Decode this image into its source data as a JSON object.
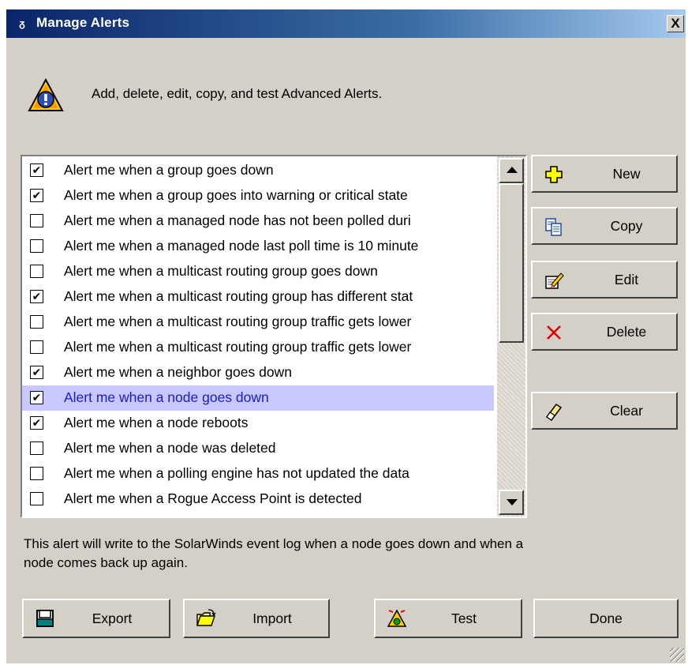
{
  "window": {
    "title": "Manage Alerts",
    "close_label": "X"
  },
  "header": {
    "text": "Add, delete, edit, copy, and test Advanced Alerts."
  },
  "alerts": [
    {
      "label": "Alert me when a group goes down",
      "checked": true
    },
    {
      "label": "Alert me when a group goes into warning or critical state",
      "checked": true
    },
    {
      "label": "Alert me when a managed node has not been polled duri",
      "checked": false
    },
    {
      "label": "Alert me when a managed node last poll time is 10 minute",
      "checked": false
    },
    {
      "label": "Alert me when a multicast routing group goes down",
      "checked": false
    },
    {
      "label": "Alert me when a multicast routing group has different stat",
      "checked": true
    },
    {
      "label": "Alert me when a multicast routing group traffic gets lower",
      "checked": false
    },
    {
      "label": "Alert me when a multicast routing group traffic gets lower",
      "checked": false
    },
    {
      "label": "Alert me when a neighbor goes down",
      "checked": true
    },
    {
      "label": "Alert me when a node goes down",
      "checked": true,
      "selected": true
    },
    {
      "label": "Alert me when a node reboots",
      "checked": true
    },
    {
      "label": "Alert me when a node was deleted",
      "checked": false
    },
    {
      "label": "Alert me when a polling engine has not updated the data",
      "checked": false
    },
    {
      "label": "Alert me when a Rogue Access Point is detected",
      "checked": false
    }
  ],
  "description": "This alert will write to the SolarWinds event log when a node goes down and when a node comes back up again.",
  "side_buttons": {
    "new": "New",
    "copy": "Copy",
    "edit": "Edit",
    "delete": "Delete",
    "clear": "Clear"
  },
  "bottom_buttons": {
    "export": "Export",
    "import": "Import",
    "test": "Test",
    "done": "Done"
  },
  "icons": {
    "title": "alert-title-icon",
    "header": "warning-triangle-icon",
    "new": "plus-icon",
    "copy": "copy-icon",
    "edit": "edit-icon",
    "delete": "x-icon",
    "clear": "eraser-icon",
    "export": "floppy-disk-icon",
    "import": "open-folder-icon",
    "test": "test-alert-icon"
  },
  "colors": {
    "selection_bg": "#c8c8ff",
    "selection_text": "#1a1acc",
    "title_bar": "#0a246a"
  }
}
